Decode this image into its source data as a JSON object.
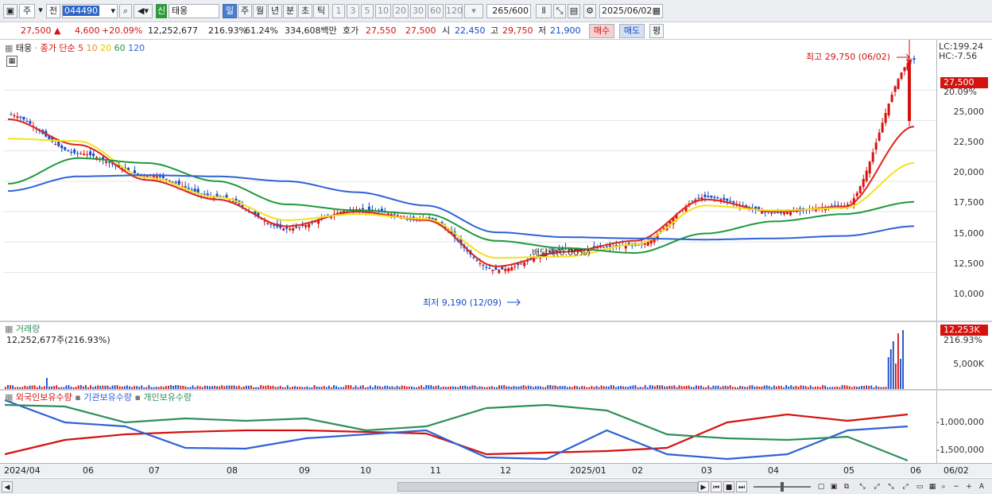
{
  "toolbar": {
    "mode_a": "주",
    "mode_b": "전",
    "code": "044490",
    "badge_new": "신",
    "stock_name": "태웅",
    "periods": [
      "일",
      "주",
      "월",
      "년",
      "분",
      "초",
      "틱"
    ],
    "intervals": [
      "1",
      "3",
      "5",
      "10",
      "20",
      "30",
      "60",
      "120"
    ],
    "count": "265",
    "count_total": "/600",
    "date": "2025/06/02"
  },
  "quote": {
    "price": "27,500",
    "change": "4,600",
    "change_rate": "+20.09%",
    "volume": "12,252,677",
    "volume_rate": "216.93%",
    "turnover": "61.24%",
    "amount": "334,608백만",
    "ask_label": "호가",
    "ask": "27,550",
    "bid": "27,500",
    "open_label": "시",
    "open": "22,450",
    "high_label": "고",
    "high": "29,750",
    "low_label": "저",
    "low": "21,900",
    "buy_label": "매수",
    "sell_label": "매도",
    "eval_label": "평"
  },
  "price_chart": {
    "name_tag": "태웅",
    "legend_prefix": "종가 단순",
    "ma_periods": [
      "5",
      "10",
      "20",
      "60",
      "120"
    ],
    "ma_colors": [
      "#e0231c",
      "#f08a1a",
      "#f4e21a",
      "#1f9a3c",
      "#2f62d8"
    ],
    "lc_label": "LC:199.24",
    "hc_label": "HC:-7.56",
    "y_ticks": [
      "25,000",
      "22,500",
      "20,000",
      "17,500",
      "15,000",
      "12,500",
      "10,000"
    ],
    "current_tag": "27,500",
    "current_rate": "20.09%",
    "high_note": "최고 29,750 (06/02)",
    "low_note": "최저 9,190 (12/09)",
    "dividend_note": "배당락(0.00%)"
  },
  "volume_chart": {
    "title": "거래량",
    "summary": "12,252,677주(216.93%)",
    "tag": "12,253K",
    "tag_rate": "216.93%",
    "y_tick": "5,000K"
  },
  "holdings_chart": {
    "legend": [
      "외국인보유수량",
      "기관보유수량",
      "개인보유수량"
    ],
    "colors": [
      "#d4120e",
      "#2f62d8",
      "#2e8f5c"
    ],
    "y_ticks": [
      "-1,000,000",
      "-1,500,000"
    ]
  },
  "x_axis": {
    "ticks": [
      "2024/04",
      "06",
      "07",
      "08",
      "09",
      "10",
      "11",
      "12",
      "2025/01",
      "02",
      "03",
      "04",
      "05",
      "06"
    ],
    "last_label": "06/02"
  },
  "chart_data": {
    "type": "line",
    "title": "",
    "x": [
      "2024/04",
      "06",
      "07",
      "08",
      "09",
      "10",
      "11",
      "12",
      "2025/01",
      "02",
      "03",
      "04",
      "05",
      "06"
    ],
    "ylim": [
      8500,
      30000
    ],
    "series": [
      {
        "name": "종가",
        "values": [
          23000,
          19800,
          18000,
          16200,
          13600,
          15200,
          14400,
          10200,
          11900,
          12200,
          16200,
          14900,
          15500,
          27500
        ]
      },
      {
        "name": "5",
        "values": [
          22600,
          20500,
          17600,
          16000,
          13800,
          15000,
          14300,
          10500,
          11700,
          12600,
          16000,
          15000,
          15400,
          22000
        ]
      },
      {
        "name": "20",
        "values": [
          21000,
          20800,
          17800,
          16200,
          14300,
          14800,
          14400,
          11200,
          11300,
          12300,
          15500,
          15100,
          15300,
          19000
        ]
      },
      {
        "name": "60",
        "values": [
          17300,
          19400,
          19000,
          17500,
          15600,
          15100,
          14800,
          12600,
          12000,
          11600,
          13200,
          14200,
          14800,
          15800
        ]
      },
      {
        "name": "120",
        "values": [
          16700,
          17900,
          18000,
          17900,
          17500,
          16600,
          15500,
          13300,
          12900,
          12800,
          12700,
          12800,
          13000,
          13800
        ]
      }
    ]
  }
}
